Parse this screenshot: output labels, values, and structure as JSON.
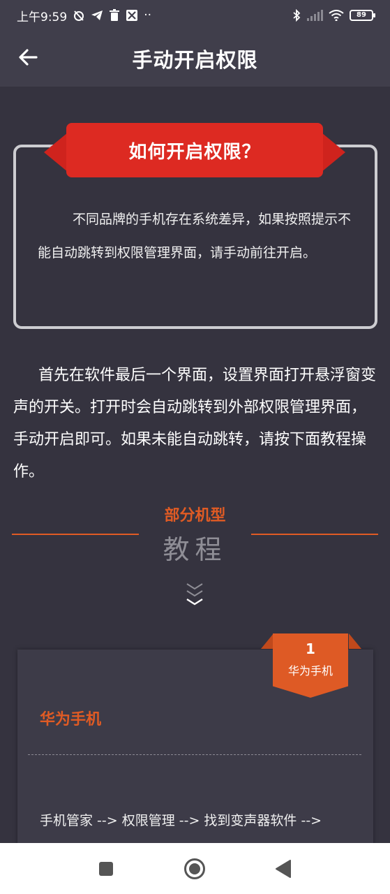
{
  "status_bar": {
    "time": "上午9:59",
    "battery": "89",
    "more": "··"
  },
  "app_bar": {
    "title": "手动开启权限"
  },
  "howto": {
    "title": "如何开启权限？",
    "text": "不同品牌的手机存在系统差异，如果按照提示不能自动跳转到权限管理界面，请手动前往开启。"
  },
  "intro": {
    "text": "首先在软件最后一个界面，设置界面打开悬浮窗变声的开关。打开时会自动跳转到外部权限管理界面，手动开启即可。如果未能自动跳转，请按下面教程操作。"
  },
  "section": {
    "subtitle": "部分机型",
    "title": "教程"
  },
  "card": {
    "badge_number": "1",
    "badge_label": "华为手机",
    "title": "华为手机",
    "step": "手机管家 --> 权限管理 --> 找到变声器软件 -->"
  },
  "colors": {
    "background": "#35333f",
    "bar": "#403e4b",
    "ribbon": "#dd2a22",
    "accent": "#e05b24"
  },
  "icons": {
    "back": "arrow-left-icon",
    "chevrons": "double-chevron-down-icon",
    "nav_recent": "square-icon",
    "nav_home": "circle-icon",
    "nav_back": "triangle-back-icon"
  }
}
